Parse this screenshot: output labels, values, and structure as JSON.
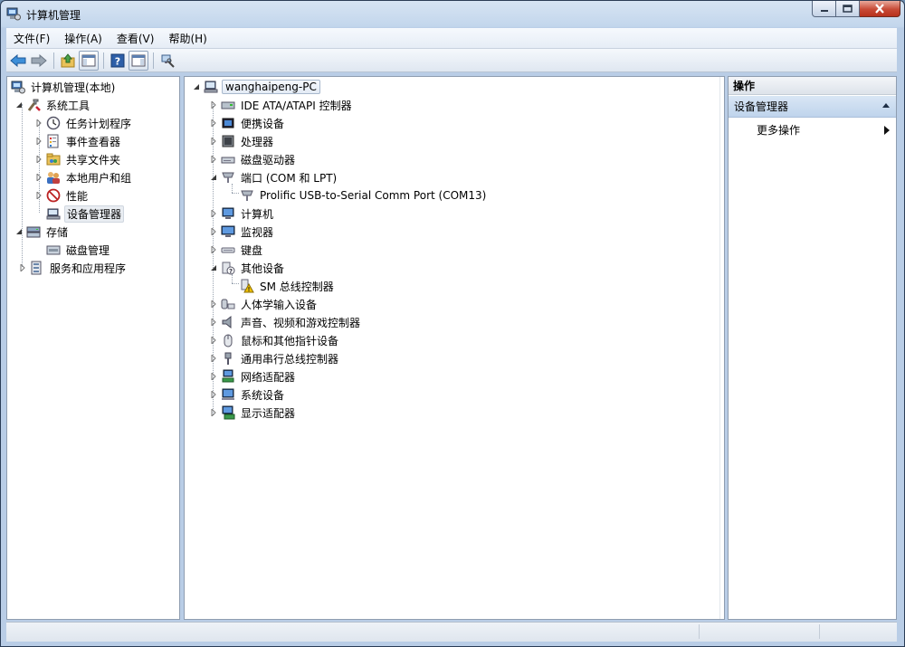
{
  "window": {
    "title": "计算机管理"
  },
  "menu": [
    "文件(F)",
    "操作(A)",
    "查看(V)",
    "帮助(H)"
  ],
  "toolbar": [
    "back-arrow-icon",
    "forward-arrow-icon",
    "up-folder-icon",
    "show-hide-tree-icon",
    "help-icon",
    "action-pane-icon",
    "properties-icon"
  ],
  "left_tree": {
    "root": "计算机管理(本地)",
    "system_tools": "系统工具",
    "task_scheduler": "任务计划程序",
    "event_viewer": "事件查看器",
    "shared_folders": "共享文件夹",
    "local_users": "本地用户和组",
    "performance": "性能",
    "device_manager": "设备管理器",
    "storage": "存储",
    "disk_management": "磁盘管理",
    "services_apps": "服务和应用程序"
  },
  "device_tree": {
    "root": "wanghaipeng-PC",
    "ide": "IDE ATA/ATAPI 控制器",
    "portable": "便携设备",
    "processor": "处理器",
    "disk_drives": "磁盘驱动器",
    "ports": "端口 (COM 和 LPT)",
    "ports_child": "Prolific USB-to-Serial Comm Port (COM13)",
    "computer": "计算机",
    "monitor": "监视器",
    "keyboard": "键盘",
    "other_devices": "其他设备",
    "other_child": "SM 总线控制器",
    "hid": "人体学输入设备",
    "sound": "声音、视频和游戏控制器",
    "mice": "鼠标和其他指针设备",
    "usb": "通用串行总线控制器",
    "network": "网络适配器",
    "system_devices": "系统设备",
    "display": "显示适配器"
  },
  "actions": {
    "header": "操作",
    "section": "设备管理器",
    "more": "更多操作"
  }
}
